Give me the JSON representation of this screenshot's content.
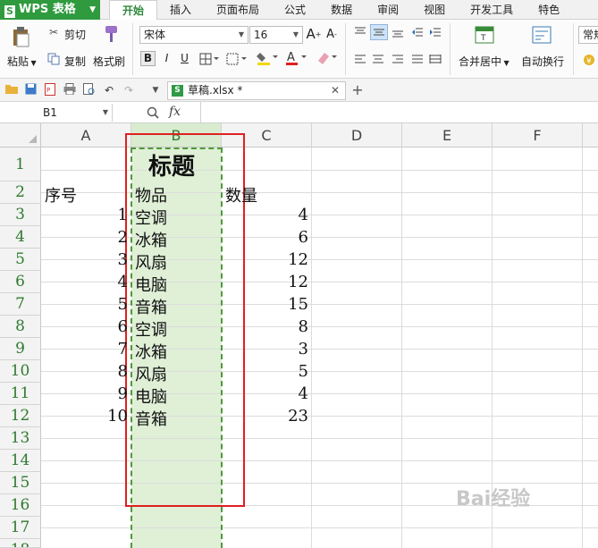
{
  "app": {
    "title": "WPS 表格"
  },
  "tabs": [
    "开始",
    "插入",
    "页面布局",
    "公式",
    "数据",
    "审阅",
    "视图",
    "开发工具",
    "特色"
  ],
  "ribbon": {
    "paste_label": "粘贴",
    "cut_label": "剪切",
    "copy_label": "复制",
    "format_painter_label": "格式刷",
    "font_name": "宋体",
    "font_size": "16",
    "bold": "B",
    "italic": "I",
    "underline": "U",
    "merge_label": "合并居中",
    "wrap_label": "自动换行",
    "number_format": "常规"
  },
  "file_tab": {
    "name": "草稿.xlsx *"
  },
  "formula_bar": {
    "name_box": "B1",
    "fx": "fx",
    "formula": ""
  },
  "grid": {
    "columns": [
      "A",
      "B",
      "C",
      "D",
      "E",
      "F"
    ],
    "rows": [
      "1",
      "2",
      "3",
      "4",
      "5",
      "6",
      "7",
      "8",
      "9",
      "10",
      "11",
      "12",
      "13",
      "14",
      "15",
      "16",
      "17",
      "18"
    ],
    "title": "标题",
    "header_a": "序号",
    "header_b": "物品",
    "header_c": "数量",
    "data": [
      {
        "a": "1",
        "b": "空调",
        "c": "4"
      },
      {
        "a": "2",
        "b": "冰箱",
        "c": "6"
      },
      {
        "a": "3",
        "b": "风扇",
        "c": "12"
      },
      {
        "a": "4",
        "b": "电脑",
        "c": "12"
      },
      {
        "a": "5",
        "b": "音箱",
        "c": "15"
      },
      {
        "a": "6",
        "b": "空调",
        "c": "8"
      },
      {
        "a": "7",
        "b": "冰箱",
        "c": "3"
      },
      {
        "a": "8",
        "b": "风扇",
        "c": "5"
      },
      {
        "a": "9",
        "b": "电脑",
        "c": "4"
      },
      {
        "a": "10",
        "b": "音箱",
        "c": "23"
      }
    ]
  },
  "watermark": "Bai经验"
}
